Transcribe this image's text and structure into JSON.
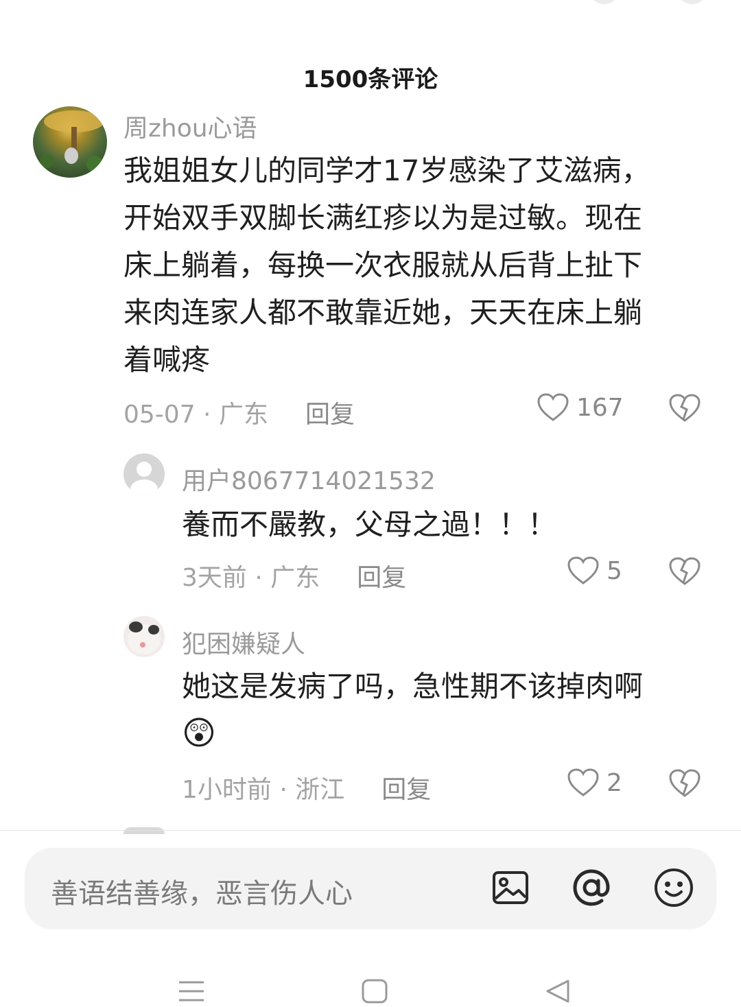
{
  "header": {
    "title": "1500条评论"
  },
  "comments": [
    {
      "username": "周zhou心语",
      "lines": [
        "我姐姐女儿的同学才17岁感染了艾滋病，",
        "开始双手双脚长满红疹以为是过敏。现在",
        "床上躺着，每换一次衣服就从后背上扯下",
        "来肉连家人都不敢靠近她，天天在床上躺",
        "着喊疼"
      ],
      "time_location": "05-07 · 广东",
      "reply_label": "回复",
      "likes": "167"
    },
    {
      "username": "用户8067714021532",
      "lines": [
        "養而不嚴教，父母之過！！！"
      ],
      "time_location": "3天前 · 广东",
      "reply_label": "回复",
      "likes": "5"
    },
    {
      "username": "犯困嫌疑人",
      "lines": [
        "她这是发病了吗，急性期不该掉肉啊"
      ],
      "emoji": "😲",
      "time_location": "1小时前 · 浙江",
      "reply_label": "回复",
      "likes": "2"
    }
  ],
  "input_bar": {
    "placeholder": "善语结善缘，恶言伤人心",
    "icons": [
      "image-icon",
      "at-icon",
      "emoji-icon"
    ]
  },
  "nav_bar": {
    "icons": [
      "menu-icon",
      "home-square-icon",
      "back-triangle-icon"
    ]
  },
  "colors": {
    "muted_text": "#9a9a9a",
    "body_text": "#1f1f1f",
    "input_bg": "#f3f3f3"
  }
}
